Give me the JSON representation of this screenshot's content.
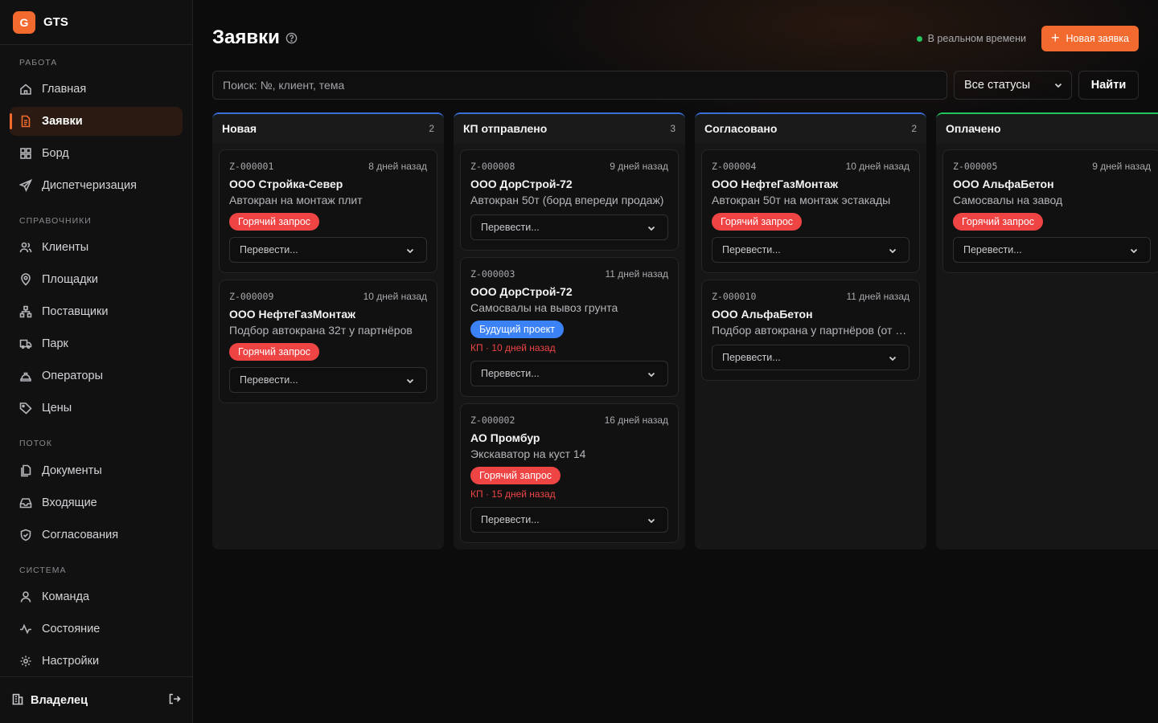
{
  "app": {
    "logo_letter": "G",
    "name": "GTS"
  },
  "sidebar": {
    "sections": {
      "work": "РАБОТА",
      "refs": "СПРАВОЧНИКИ",
      "flow": "ПОТОК",
      "system": "СИСТЕМА"
    },
    "items": {
      "home": "Главная",
      "requests": "Заявки",
      "board": "Борд",
      "dispatch": "Диспетчеризация",
      "clients": "Клиенты",
      "sites": "Площадки",
      "suppliers": "Поставщики",
      "fleet": "Парк",
      "operators": "Операторы",
      "prices": "Цены",
      "documents": "Документы",
      "inbox": "Входящие",
      "approvals": "Согласования",
      "team": "Команда",
      "status": "Состояние",
      "settings": "Настройки"
    },
    "active": "requests",
    "footer_user": "Владелец"
  },
  "header": {
    "title": "Заявки",
    "realtime": "В реальном времени",
    "new_button": "Новая заявка"
  },
  "filters": {
    "search_placeholder": "Поиск: №, клиент, тема",
    "status_value": "Все статусы",
    "find_button": "Найти"
  },
  "accent": "#f26a2e",
  "board": {
    "move_placeholder": "Перевести...",
    "columns": [
      {
        "title": "Новая",
        "count": "2",
        "cards": [
          {
            "num": "Z-000001",
            "ago": "8 дней назад",
            "client": "ООО Стройка-Север",
            "topic": "Автокран на монтаж плит",
            "badge": "Горячий запрос"
          },
          {
            "num": "Z-000009",
            "ago": "10 дней назад",
            "client": "ООО НефтеГазМонтаж",
            "topic": "Подбор автокрана 32т у партнёров",
            "badge": "Горячий запрос"
          }
        ]
      },
      {
        "title": "КП отправлено",
        "count": "3",
        "cards": [
          {
            "num": "Z-000008",
            "ago": "9 дней назад",
            "client": "ООО ДорСтрой-72",
            "topic": "Автокран 50т (борд впереди продаж)"
          },
          {
            "num": "Z-000003",
            "ago": "11 дней назад",
            "client": "ООО ДорСтрой-72",
            "topic": "Самосвалы на вывоз грунта",
            "badge": "Будущий проект",
            "kp": "КП · 10 дней назад"
          },
          {
            "num": "Z-000002",
            "ago": "16 дней назад",
            "client": "АО Промбур",
            "topic": "Экскаватор на куст 14",
            "badge": "Горячий запрос",
            "kp": "КП · 15 дней назад"
          }
        ]
      },
      {
        "title": "Согласовано",
        "count": "2",
        "cards": [
          {
            "num": "Z-000004",
            "ago": "10 дней назад",
            "client": "ООО НефтеГазМонтаж",
            "topic": "Автокран 50т на монтаж эстакады",
            "badge": "Горячий запрос"
          },
          {
            "num": "Z-000010",
            "ago": "11 дней назад",
            "client": "ООО АльфаБетон",
            "topic": "Подбор автокрана у партнёров (от клиента)"
          }
        ]
      },
      {
        "title": "Оплачено",
        "count": "",
        "cards": [
          {
            "num": "Z-000005",
            "ago": "9 дней назад",
            "client": "ООО АльфаБетон",
            "topic": "Самосвалы на завод",
            "badge": "Горячий запрос"
          }
        ]
      }
    ]
  }
}
